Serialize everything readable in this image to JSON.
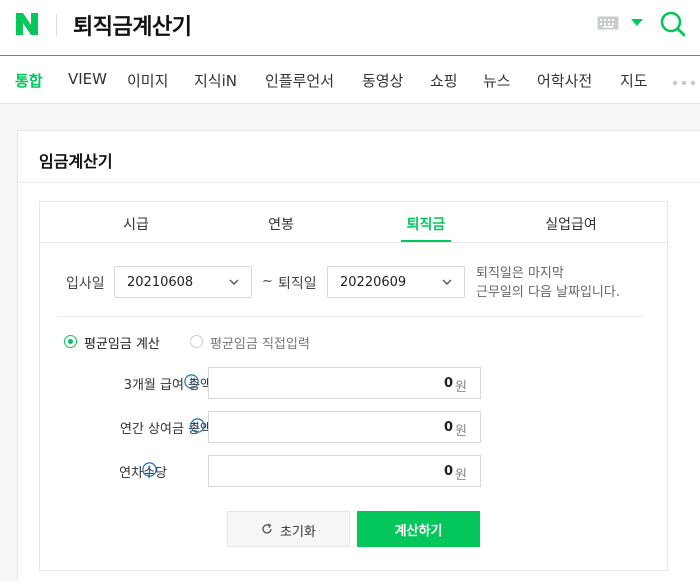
{
  "header": {
    "logo_letter": "N",
    "search_query": "퇴직금계산기"
  },
  "nav": {
    "items": [
      "통합",
      "VIEW",
      "이미지",
      "지식iN",
      "인플루언서",
      "동영상",
      "쇼핑",
      "뉴스",
      "어학사전",
      "지도"
    ],
    "active_index": 0
  },
  "calculator": {
    "title": "임금계산기",
    "tabs": [
      "시급",
      "연봉",
      "퇴직금",
      "실업급여"
    ],
    "active_tab": 2,
    "join_date_label": "입사일",
    "join_date_value": "20210608",
    "range_sep": "~",
    "leave_date_label": "퇴직일",
    "leave_date_value": "20220609",
    "note_line1": "퇴직일은 마지막",
    "note_line2": "근무일의 다음 날짜입니다.",
    "radio_average": "평균임금 계산",
    "radio_direct": "평균임금 직접입력",
    "field_salary_label": "3개월 급여 총액",
    "field_salary_value": "0",
    "field_bonus_label": "연간 상여금 총액",
    "field_bonus_value": "0",
    "field_allowance_label": "연차수당",
    "field_allowance_value": "0",
    "currency_unit": "원",
    "reset_label": "초기화",
    "calc_label": "계산하기"
  },
  "colors": {
    "brand": "#03c75a"
  }
}
